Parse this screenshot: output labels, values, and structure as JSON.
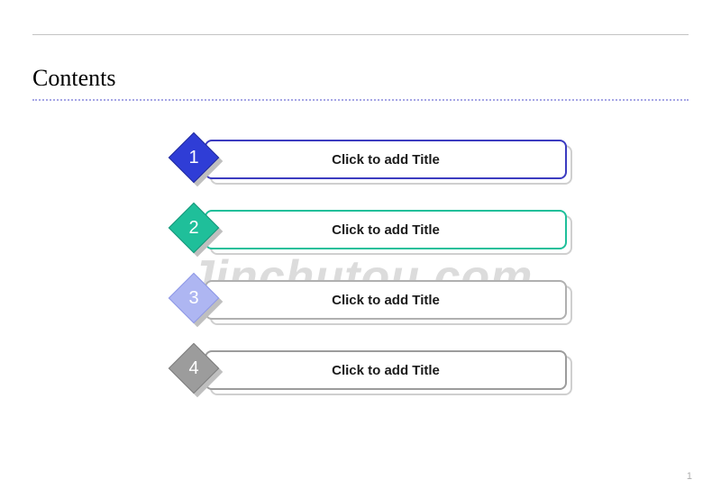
{
  "title": "Contents",
  "watermark": "Jinchutou.com",
  "page_number": "1",
  "items": [
    {
      "num": "1",
      "label": "Click to add Title",
      "bar_border": "#3c3cc0",
      "diamond_fill": "#2f3dd6",
      "diamond_border": "#202a9c"
    },
    {
      "num": "2",
      "label": "Click to add Title",
      "bar_border": "#1fbf9a",
      "diamond_fill": "#1fbf9a",
      "diamond_border": "#149578"
    },
    {
      "num": "3",
      "label": "Click to add Title",
      "bar_border": "#b0b0b0",
      "diamond_fill": "#aeb6f2",
      "diamond_border": "#8d97e6"
    },
    {
      "num": "4",
      "label": "Click to add Title",
      "bar_border": "#9c9c9c",
      "diamond_fill": "#9c9c9c",
      "diamond_border": "#7d7d7d"
    }
  ]
}
